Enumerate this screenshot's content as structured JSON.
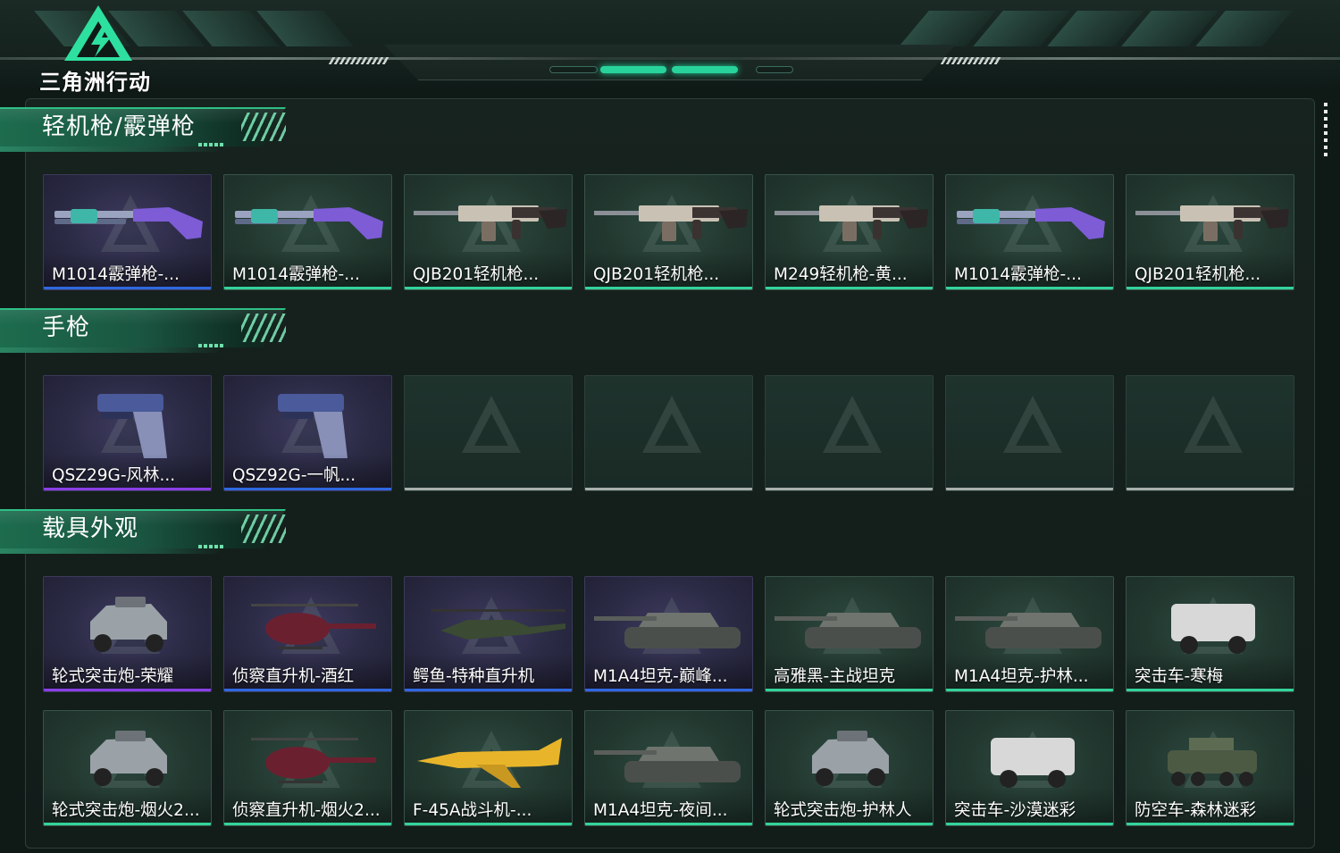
{
  "header": {
    "logo_text": "三角洲行动",
    "accent_color": "#28d39b"
  },
  "sections": [
    {
      "title": "轻机枪/霰弹枪",
      "items": [
        {
          "label": "M1014霰弹枪-...",
          "rarity": "blue",
          "bg": "purple",
          "icon": "shotgun-icon"
        },
        {
          "label": "M1014霰弹枪-...",
          "rarity": "green",
          "bg": "green",
          "icon": "shotgun-icon"
        },
        {
          "label": "QJB201轻机枪...",
          "rarity": "green",
          "bg": "green",
          "icon": "machine-gun-icon"
        },
        {
          "label": "QJB201轻机枪...",
          "rarity": "green",
          "bg": "green",
          "icon": "machine-gun-icon"
        },
        {
          "label": "M249轻机枪-黄...",
          "rarity": "green",
          "bg": "green",
          "icon": "machine-gun-icon"
        },
        {
          "label": "M1014霰弹枪-...",
          "rarity": "green",
          "bg": "green",
          "icon": "shotgun-icon"
        },
        {
          "label": "QJB201轻机枪...",
          "rarity": "green",
          "bg": "green",
          "icon": "machine-gun-icon"
        }
      ]
    },
    {
      "title": "手枪",
      "items": [
        {
          "label": "QSZ29G-风林...",
          "rarity": "purple",
          "bg": "purple",
          "icon": "pistol-icon"
        },
        {
          "label": "QSZ92G-一帆...",
          "rarity": "blue",
          "bg": "purple",
          "icon": "pistol-icon"
        },
        {
          "label": "",
          "rarity": "grey",
          "bg": "empty",
          "icon": "empty-slot-icon"
        },
        {
          "label": "",
          "rarity": "grey",
          "bg": "empty",
          "icon": "empty-slot-icon"
        },
        {
          "label": "",
          "rarity": "grey",
          "bg": "empty",
          "icon": "empty-slot-icon"
        },
        {
          "label": "",
          "rarity": "grey",
          "bg": "empty",
          "icon": "empty-slot-icon"
        },
        {
          "label": "",
          "rarity": "grey",
          "bg": "empty",
          "icon": "empty-slot-icon"
        }
      ]
    },
    {
      "title": "载具外观",
      "items": [
        {
          "label": "轮式突击炮-荣耀",
          "rarity": "purple",
          "bg": "purple",
          "icon": "armored-car-icon"
        },
        {
          "label": "侦察直升机-酒红",
          "rarity": "blue",
          "bg": "purple",
          "icon": "helicopter-icon"
        },
        {
          "label": "鳄鱼-特种直升机",
          "rarity": "blue",
          "bg": "purple",
          "icon": "attack-helicopter-icon"
        },
        {
          "label": "M1A4坦克-巅峰...",
          "rarity": "blue",
          "bg": "purple",
          "icon": "tank-icon"
        },
        {
          "label": "高雅黑-主战坦克",
          "rarity": "green",
          "bg": "green",
          "icon": "tank-icon"
        },
        {
          "label": "M1A4坦克-护林...",
          "rarity": "green",
          "bg": "green",
          "icon": "tank-icon"
        },
        {
          "label": "突击车-寒梅",
          "rarity": "green",
          "bg": "green",
          "icon": "assault-vehicle-icon"
        },
        {
          "label": "轮式突击炮-烟火2...",
          "rarity": "green",
          "bg": "green",
          "icon": "armored-car-icon"
        },
        {
          "label": "侦察直升机-烟火2...",
          "rarity": "green",
          "bg": "green",
          "icon": "helicopter-icon"
        },
        {
          "label": "F-45A战斗机-...",
          "rarity": "green",
          "bg": "green",
          "icon": "fighter-jet-icon"
        },
        {
          "label": "M1A4坦克-夜间...",
          "rarity": "green",
          "bg": "green",
          "icon": "tank-icon"
        },
        {
          "label": "轮式突击炮-护林人",
          "rarity": "green",
          "bg": "green",
          "icon": "armored-car-icon"
        },
        {
          "label": "突击车-沙漠迷彩",
          "rarity": "green",
          "bg": "green",
          "icon": "assault-vehicle-icon"
        },
        {
          "label": "防空车-森林迷彩",
          "rarity": "green",
          "bg": "green",
          "icon": "anti-air-vehicle-icon"
        }
      ]
    }
  ]
}
